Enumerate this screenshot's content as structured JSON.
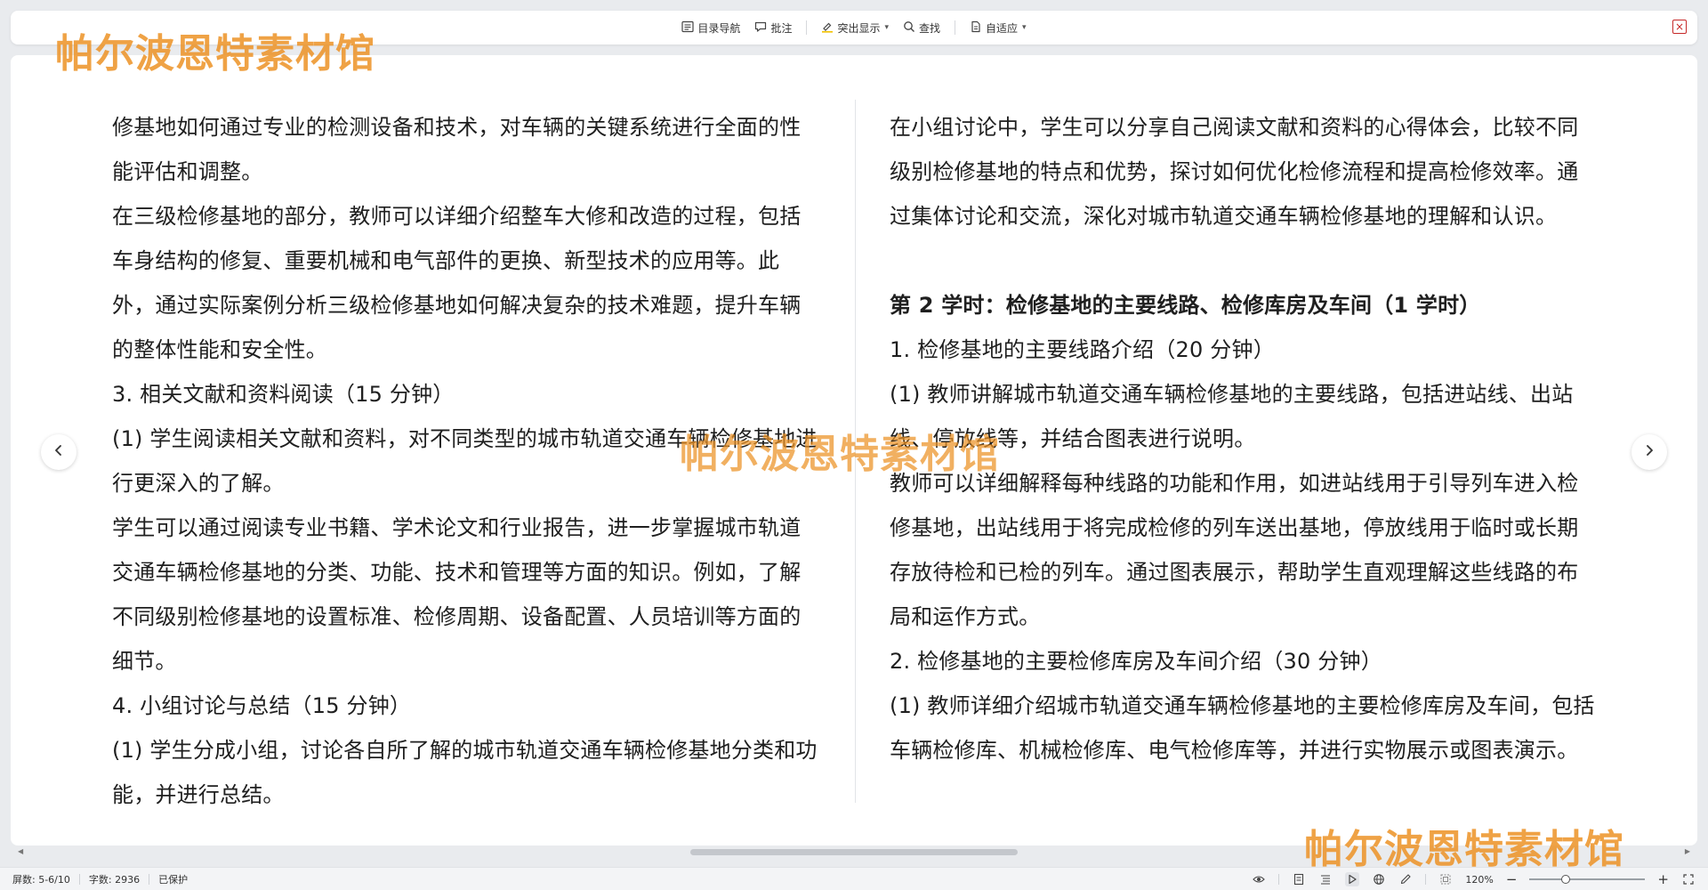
{
  "toolbar": {
    "catalog_label": "目录导航",
    "annotate_label": "批注",
    "highlight_label": "突出显示",
    "find_label": "查找",
    "fit_label": "自适应",
    "close_symbol": "×"
  },
  "document": {
    "left_column": [
      "修基地如何通过专业的检测设备和技术，对车辆的关键系统进行全面的性能评估和调整。",
      "在三级检修基地的部分，教师可以详细介绍整车大修和改造的过程，包括车身结构的修复、重要机械和电气部件的更换、新型技术的应用等。此外，通过实际案例分析三级检修基地如何解决复杂的技术难题，提升车辆的整体性能和安全性。",
      "3.  相关文献和资料阅读（15 分钟）",
      "(1)  学生阅读相关文献和资料，对不同类型的城市轨道交通车辆检修基地进行更深入的了解。",
      "学生可以通过阅读专业书籍、学术论文和行业报告，进一步掌握城市轨道交通车辆检修基地的分类、功能、技术和管理等方面的知识。例如，了解不同级别检修基地的设置标准、检修周期、设备配置、人员培训等方面的细节。",
      "4.  小组讨论与总结（15 分钟）",
      "(1)  学生分成小组，讨论各自所了解的城市轨道交通车辆检修基地分类和功能，并进行总结。"
    ],
    "right_column": {
      "p1": "在小组讨论中，学生可以分享自己阅读文献和资料的心得体会，比较不同级别检修基地的特点和优势，探讨如何优化检修流程和提高检修效率。通过集体讨论和交流，深化对城市轨道交通车辆检修基地的理解和认识。",
      "heading": "第 2 学时：检修基地的主要线路、检修库房及车间（1 学时）",
      "p2": "1.  检修基地的主要线路介绍（20 分钟）",
      "p3": "(1)  教师讲解城市轨道交通车辆检修基地的主要线路，包括进站线、出站线、停放线等，并结合图表进行说明。",
      "p4": "教师可以详细解释每种线路的功能和作用，如进站线用于引导列车进入检修基地，出站线用于将完成检修的列车送出基地，停放线用于临时或长期存放待检和已检的列车。通过图表展示，帮助学生直观理解这些线路的布局和运作方式。",
      "p5": "2.  检修基地的主要检修库房及车间介绍（30 分钟）",
      "p6": "(1)  教师详细介绍城市轨道交通车辆检修基地的主要检修库房及车间，包括车辆检修库、机械检修库、电气检修库等，并进行实物展示或图表演示。"
    }
  },
  "statusbar": {
    "page_info": "屏数: 5-6/10",
    "word_count": "字数: 2936",
    "protect_status": "已保护",
    "zoom_level": "120%",
    "zoom_minus": "−",
    "zoom_plus": "+",
    "zoom_fraction": 0.3
  },
  "watermark": {
    "text": "帕尔波恩特素材馆"
  },
  "colors": {
    "watermark": "#ec9224",
    "close_red": "#c62828",
    "background": "#e9ebee"
  },
  "icons": {
    "catalog": "list-icon",
    "annotate": "comment-icon",
    "highlight": "highlighter-icon",
    "find": "search-icon",
    "fit": "document-icon",
    "prev": "chevron-left-icon",
    "next": "chevron-right-icon"
  }
}
